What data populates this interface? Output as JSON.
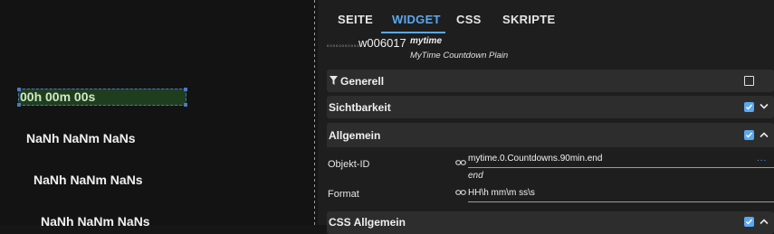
{
  "canvas": {
    "selected_widget_text": "00h 00m 00s",
    "countdowns": [
      "NaNh NaNm NaNs",
      "NaNh NaNm NaNs",
      "NaNh NaNm NaNs"
    ]
  },
  "tabs": [
    {
      "label": "SEITE",
      "active": false
    },
    {
      "label": "WIDGET",
      "active": true
    },
    {
      "label": "CSS",
      "active": false
    },
    {
      "label": "SKRIPTE",
      "active": false
    }
  ],
  "widget": {
    "tiny_text": "0 0 0 0 0 0 0 0 0 0 0",
    "id": "w006017",
    "set": "mytime",
    "name": "MyTime Countdown Plain"
  },
  "groups": {
    "generell": {
      "title": "Generell",
      "checked": false
    },
    "sichtbarkeit": {
      "title": "Sichtbarkeit",
      "checked": true
    },
    "allgemein": {
      "title": "Allgemein",
      "checked": true
    },
    "css_allgemein": {
      "title": "CSS Allgemein",
      "checked": true
    }
  },
  "fields": {
    "objekt_id": {
      "label": "Objekt-ID",
      "value": "mytime.0.Countdowns.90min.end",
      "hint": "end",
      "more": "..."
    },
    "format": {
      "label": "Format",
      "value": "HH\\h mm\\m ss\\s"
    }
  },
  "colors": {
    "accent": "#5aa8f0",
    "panel_bg": "#1e1e1e",
    "group_bg": "#2d2d2d",
    "canvas_bg": "#131313"
  }
}
